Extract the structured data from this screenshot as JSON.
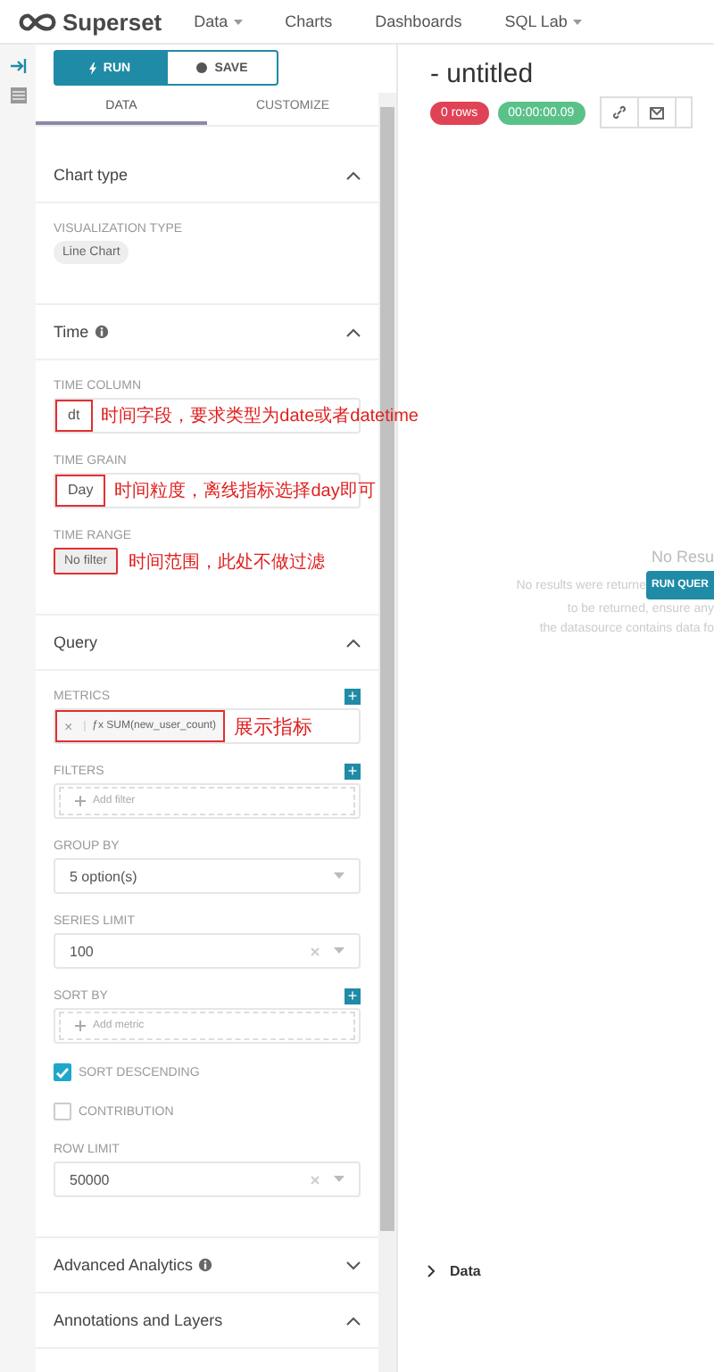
{
  "header": {
    "logo": "Superset",
    "nav": [
      {
        "label": "Data",
        "dropdown": true
      },
      {
        "label": "Charts",
        "dropdown": false
      },
      {
        "label": "Dashboards",
        "dropdown": false
      },
      {
        "label": "SQL Lab",
        "dropdown": true
      }
    ]
  },
  "actions": {
    "run": "RUN",
    "save": "SAVE"
  },
  "tabs": [
    {
      "label": "DATA",
      "selected": true
    },
    {
      "label": "CUSTOMIZE",
      "selected": false
    }
  ],
  "sections": [
    {
      "title": "Chart type",
      "info": false,
      "expanded": true,
      "controls": [
        {
          "kind": "pill",
          "label": "VISUALIZATION TYPE",
          "value": "Line Chart",
          "highlighted": false
        }
      ]
    },
    {
      "title": "Time",
      "info": true,
      "expanded": true,
      "controls": [
        {
          "kind": "select",
          "label": "TIME COLUMN",
          "value": "dt",
          "highlighted": true,
          "note": "时间字段，要求类型为date或者datetime"
        },
        {
          "kind": "select",
          "label": "TIME GRAIN",
          "value": "Day",
          "highlighted": true,
          "note": "时间粒度，离线指标选择day即可"
        },
        {
          "kind": "pill",
          "label": "TIME RANGE",
          "value": "No filter",
          "highlighted": true,
          "note": "时间范围，此处不做过滤"
        }
      ]
    },
    {
      "title": "Query",
      "info": false,
      "expanded": true,
      "controls": [
        {
          "kind": "metric",
          "label": "METRICS",
          "add": "+",
          "remove": "×",
          "fx": "ƒx",
          "value": "SUM(new_user_count)",
          "highlighted": true,
          "note": "展示指标"
        },
        {
          "kind": "dashed",
          "label": "FILTERS",
          "add": "+",
          "placeholder": "Add filter"
        },
        {
          "kind": "select",
          "label": "GROUP BY",
          "value": "5 option(s)",
          "clearable": false,
          "highlighted": false
        },
        {
          "kind": "select",
          "label": "SERIES LIMIT",
          "value": "100",
          "clearable": true,
          "highlighted": false
        },
        {
          "kind": "dashed",
          "label": "SORT BY",
          "add": "+",
          "placeholder": "Add metric"
        },
        {
          "kind": "checkbox",
          "label": "SORT DESCENDING",
          "checked": true
        },
        {
          "kind": "checkbox",
          "label": "CONTRIBUTION",
          "checked": false
        },
        {
          "kind": "select",
          "label": "ROW LIMIT",
          "value": "50000",
          "clearable": true,
          "highlighted": false
        }
      ]
    },
    {
      "title": "Advanced Analytics",
      "info": true,
      "expanded": false
    },
    {
      "title": "Annotations and Layers",
      "info": false,
      "expanded": true
    }
  ],
  "chart": {
    "title": "- untitled",
    "badges": [
      {
        "text": "0 rows",
        "color": "#e04355"
      },
      {
        "text": "00:00:00.09",
        "color": "#5ac189"
      }
    ],
    "empty": {
      "heading": "No Resu",
      "lines": [
        "No results were returne",
        "to be returned, ensure any",
        "the datasource contains data fo"
      ],
      "button": "RUN QUER"
    },
    "data_panel": {
      "label": "Data",
      "expanded": false
    }
  }
}
